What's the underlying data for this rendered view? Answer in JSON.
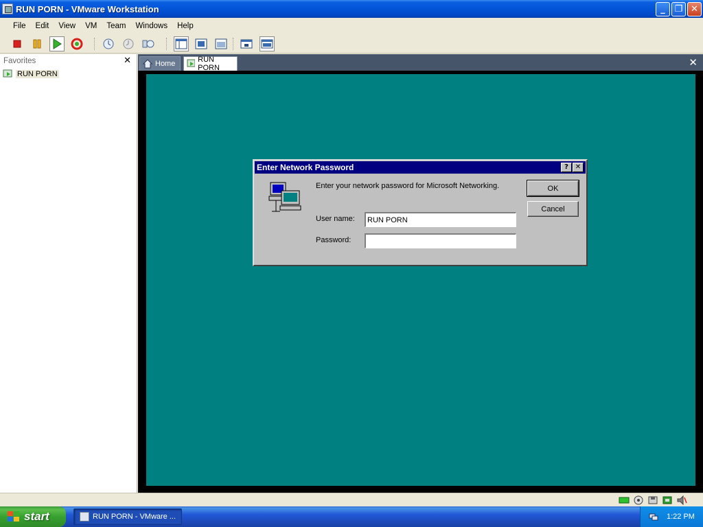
{
  "window": {
    "title": "RUN PORN - VMware Workstation"
  },
  "menu": [
    "File",
    "Edit",
    "View",
    "VM",
    "Team",
    "Windows",
    "Help"
  ],
  "toolbar": {
    "icons": [
      "power-off-icon",
      "suspend-icon",
      "power-on-icon",
      "reset-icon",
      "snapshot-take-icon",
      "snapshot-revert-icon",
      "snapshot-manager-icon",
      "show-sidebar-icon",
      "full-screen-icon",
      "quick-switch-icon",
      "console-view-icon",
      "summary-view-icon"
    ]
  },
  "sidebar": {
    "header": "Favorites",
    "items": [
      "RUN PORN"
    ]
  },
  "tabs": [
    {
      "label": "Home",
      "active": false
    },
    {
      "label": "RUN PORN",
      "active": true
    }
  ],
  "guest": {
    "background": "#008080",
    "dialog": {
      "title": "Enter Network Password",
      "message": "Enter your network password for Microsoft Networking.",
      "user_label": "User name:",
      "user_value": "RUN PORN",
      "password_label": "Password:",
      "password_value": "",
      "ok_label": "OK",
      "cancel_label": "Cancel"
    }
  },
  "taskbar": {
    "start_label": "start",
    "task_label": "RUN PORN - VMware ...",
    "clock": "1:22 PM"
  },
  "colors": {
    "xp_title": "#0354d6",
    "win95_title": "#000080",
    "win95_face": "#c0c0c0",
    "tabbar": "#47556b"
  }
}
